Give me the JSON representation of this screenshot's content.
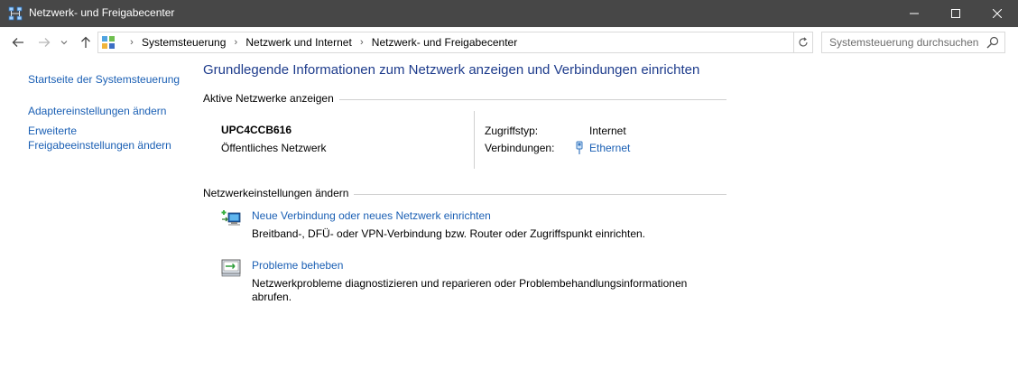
{
  "window": {
    "title": "Netzwerk- und Freigabecenter"
  },
  "breadcrumb": [
    "Systemsteuerung",
    "Netzwerk und Internet",
    "Netzwerk- und Freigabecenter"
  ],
  "search": {
    "placeholder": "Systemsteuerung durchsuchen"
  },
  "sidebar": {
    "items": [
      {
        "label": "Startseite der Systemsteuerung"
      },
      {
        "label": "Adaptereinstellungen ändern"
      },
      {
        "label": "Erweiterte"
      },
      {
        "label": "Freigabeeinstellungen ändern"
      }
    ]
  },
  "main": {
    "heading": "Grundlegende Informationen zum Netzwerk anzeigen und Verbindungen einrichten",
    "active_section_title": "Aktive Netzwerke anzeigen",
    "network": {
      "name": "UPC4CCB616",
      "type": "Öffentliches Netzwerk",
      "access_label": "Zugriffstyp:",
      "access_value": "Internet",
      "connections_label": "Verbindungen:",
      "connections_value": "Ethernet"
    },
    "settings_section_title": "Netzwerkeinstellungen ändern",
    "tasks": [
      {
        "link": "Neue Verbindung oder neues Netzwerk einrichten",
        "description": "Breitband-, DFÜ- oder VPN-Verbindung bzw. Router oder Zugriffspunkt einrichten.",
        "icon": "network-setup-icon"
      },
      {
        "link": "Probleme beheben",
        "description_lines": [
          "Netzwerkprobleme diagnostizieren und reparieren oder Problembehandlungsinformationen",
          "abrufen."
        ],
        "icon": "troubleshoot-icon"
      }
    ]
  },
  "colors": {
    "titlebar": "#474747",
    "link": "#1a5fb4",
    "heading": "#1e3c8c"
  }
}
